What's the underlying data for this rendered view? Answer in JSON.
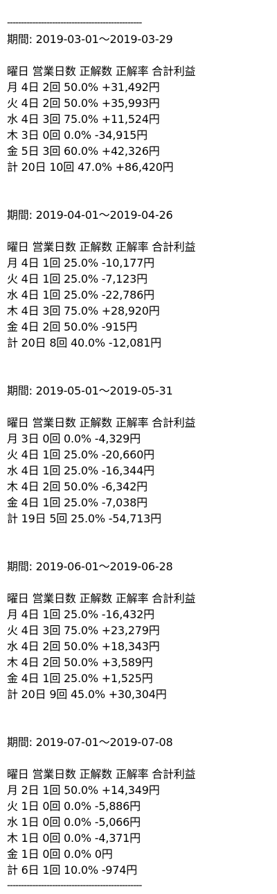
{
  "separator": "------------------------------------------------",
  "header": "曜日 営業日数 正解数 正解率 合計利益",
  "periods": [
    {
      "label": "期間: 2019-03-01～2019-03-29",
      "rows": [
        "月 4日 2回 50.0% +31,492円",
        "火 4日 2回 50.0% +35,993円",
        "水 4日 3回 75.0% +11,524円",
        "木 3日 0回 0.0% -34,915円",
        "金 5日 3回 60.0% +42,326円",
        "計 20日 10回 47.0% +86,420円"
      ]
    },
    {
      "label": "期間: 2019-04-01～2019-04-26",
      "rows": [
        "月 4日 1回 25.0% -10,177円",
        "火 4日 1回 25.0% -7,123円",
        "水 4日 1回 25.0% -22,786円",
        "木 4日 3回 75.0% +28,920円",
        "金 4日 2回 50.0% -915円",
        "計 20日 8回 40.0% -12,081円"
      ]
    },
    {
      "label": "期間: 2019-05-01～2019-05-31",
      "rows": [
        "月 3日 0回 0.0% -4,329円",
        "火 4日 1回 25.0% -20,660円",
        "水 4日 1回 25.0% -16,344円",
        "木 4日 2回 50.0% -6,342円",
        "金 4日 1回 25.0% -7,038円",
        "計 19日 5回 25.0% -54,713円"
      ]
    },
    {
      "label": "期間: 2019-06-01～2019-06-28",
      "rows": [
        "月 4日 1回 25.0% -16,432円",
        "火 4日 3回 75.0% +23,279円",
        "水 4日 2回 50.0% +18,343円",
        "木 4日 2回 50.0% +3,589円",
        "金 4日 1回 25.0% +1,525円",
        "計 20日 9回 45.0% +30,304円"
      ]
    },
    {
      "label": "期間: 2019-07-01～2019-07-08",
      "rows": [
        "月 2日 1回 50.0% +14,349円",
        "火 1日 0回 0.0% -5,886円",
        "水 1日 0回 0.0% -5,066円",
        "木 1日 0回 0.0% -4,371円",
        "金 1日 0回 0.0% 0円",
        "計 6日 1回 10.0% -974円"
      ]
    }
  ]
}
